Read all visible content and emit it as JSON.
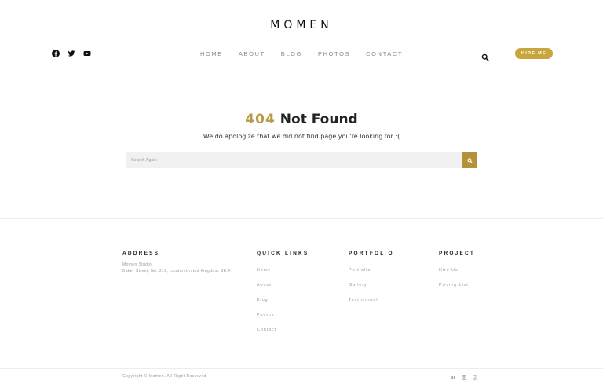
{
  "header": {
    "logo": "MOMEN",
    "social": [
      "facebook-icon",
      "twitter-icon",
      "youtube-icon"
    ],
    "nav": [
      "HOME",
      "ABOUT",
      "BLOG",
      "PHOTOS",
      "CONTACT"
    ],
    "hire_label": "HIRE ME"
  },
  "main": {
    "code": "404",
    "title": "Not Found",
    "message": "We do apologize that we did not find page you're looking for :(",
    "search_placeholder": "Search Again"
  },
  "footer": {
    "address": {
      "heading": "ADDRESS",
      "line1": "Momen Studio",
      "line2": "Baker Street, No. 212, London United Kingdom, 3E.F."
    },
    "quick_links": {
      "heading": "QUICK LINKS",
      "items": [
        "Home",
        "About",
        "Blog",
        "Photos",
        "Contact"
      ]
    },
    "portfolio": {
      "heading": "PORTFOLIO",
      "items": [
        "Portfolio",
        "Gallery",
        "Testimonial"
      ]
    },
    "project": {
      "heading": "PROJECT",
      "items": [
        "Hire Us",
        "Pricing List"
      ]
    },
    "copyright": "Copyright © Momen. All Right Reserved",
    "social": [
      "behance-icon",
      "instagram-icon",
      "pinterest-icon"
    ]
  },
  "colors": {
    "accent": "#c9a53d",
    "accent_dark": "#b3923a",
    "code": "#b99b45"
  }
}
